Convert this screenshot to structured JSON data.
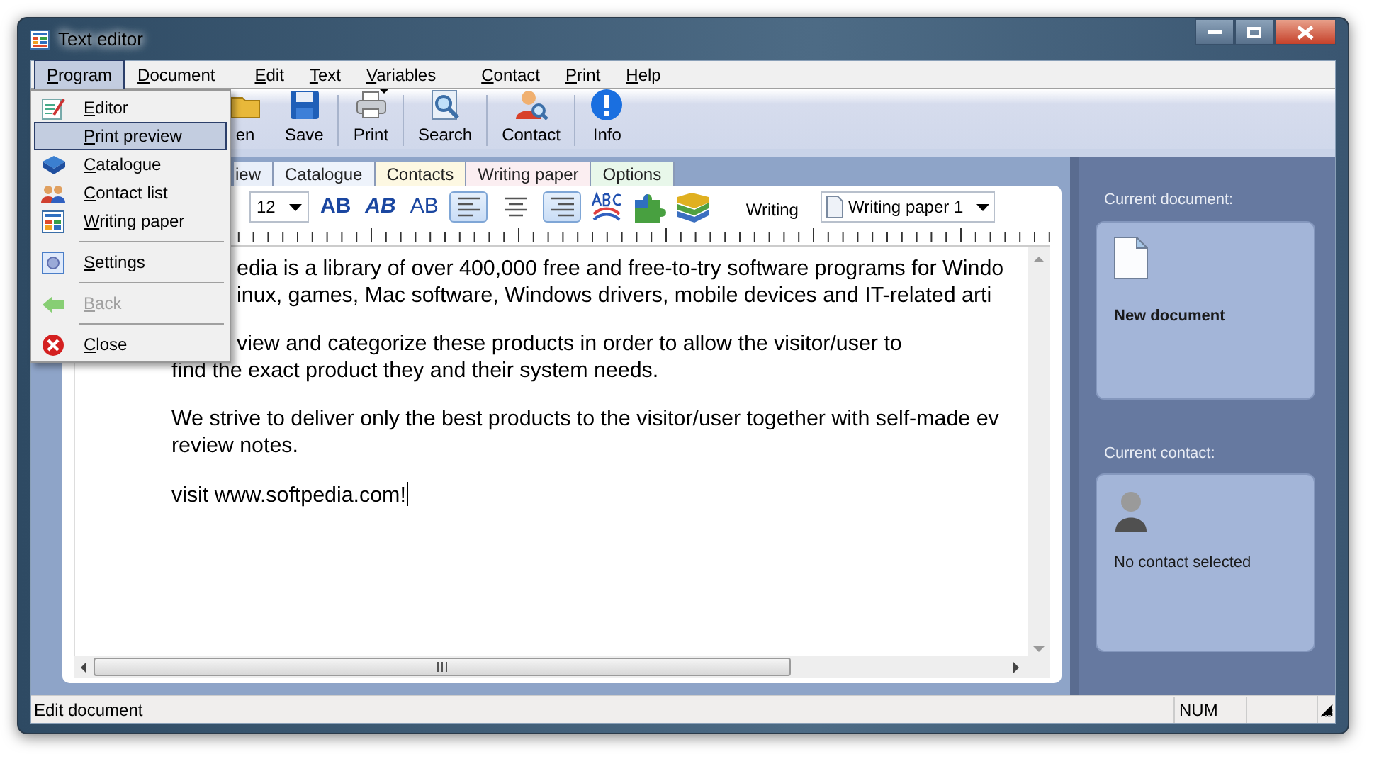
{
  "window": {
    "title": "Text editor"
  },
  "menu_bar": [
    {
      "label": "Program",
      "selected": true
    },
    {
      "label": "Document",
      "selected": false
    },
    {
      "label": "Edit",
      "selected": false
    },
    {
      "label": "Text",
      "selected": false
    },
    {
      "label": "Variables",
      "selected": false
    },
    {
      "label": "Contact",
      "selected": false
    },
    {
      "label": "Print",
      "selected": false
    },
    {
      "label": "Help",
      "selected": false
    }
  ],
  "open_menu": [
    {
      "kind": "item",
      "label": "Editor",
      "selected": false,
      "disabled": false
    },
    {
      "kind": "item",
      "label": "Print preview",
      "selected": true,
      "disabled": false
    },
    {
      "kind": "item",
      "label": "Catalogue",
      "selected": false,
      "disabled": false
    },
    {
      "kind": "item",
      "label": "Contact list",
      "selected": false,
      "disabled": false
    },
    {
      "kind": "item",
      "label": "Writing paper",
      "selected": false,
      "disabled": false
    },
    {
      "kind": "separator"
    },
    {
      "kind": "item",
      "label": "Settings",
      "selected": false,
      "disabled": false
    },
    {
      "kind": "separator"
    },
    {
      "kind": "item",
      "label": "Back",
      "selected": false,
      "disabled": true
    },
    {
      "kind": "separator"
    },
    {
      "kind": "item",
      "label": "Close",
      "selected": false,
      "disabled": false
    }
  ],
  "toolbar": [
    {
      "kind": "button",
      "label": "en"
    },
    {
      "kind": "button",
      "label": "Save"
    },
    {
      "kind": "separator"
    },
    {
      "kind": "button",
      "label": "Print"
    },
    {
      "kind": "separator"
    },
    {
      "kind": "button",
      "label": "Search"
    },
    {
      "kind": "separator"
    },
    {
      "kind": "button",
      "label": "Contact"
    },
    {
      "kind": "separator"
    },
    {
      "kind": "button",
      "label": "Info"
    }
  ],
  "tabs": [
    {
      "label": "iew",
      "color": "#e9eff9"
    },
    {
      "label": "Catalogue",
      "color": "#eef3fb"
    },
    {
      "label": "Contacts",
      "color": "#fdf8e2"
    },
    {
      "label": "Writing paper",
      "color": "#fbeef1"
    },
    {
      "label": "Options",
      "color": "#e8f7ea"
    }
  ],
  "format_bar": {
    "font_size": "12",
    "styles": [
      {
        "kind": "bold",
        "label": "AB"
      },
      {
        "kind": "italic",
        "label": "AB"
      },
      {
        "kind": "plain",
        "label": "AB"
      }
    ],
    "alignment": [
      {
        "kind": "left",
        "pressed": true
      },
      {
        "kind": "center",
        "pressed": false
      },
      {
        "kind": "right",
        "pressed": true
      }
    ],
    "writing_label": "Writing",
    "paper": "Writing paper 1"
  },
  "editor": {
    "lines": [
      {
        "kind": "covered",
        "text": "edia is a library of over 400,000 free and free-to-try software programs for Windo"
      },
      {
        "kind": "covered",
        "text": "inux, games, Mac software, Windows drivers, mobile devices and IT-related arti"
      },
      {
        "kind": "gap"
      },
      {
        "kind": "covered",
        "text": "view and categorize these products in order to allow the visitor/user to"
      },
      {
        "kind": "full",
        "text": "find the exact product they and their system needs."
      },
      {
        "kind": "gap"
      },
      {
        "kind": "full",
        "text": "We strive to deliver only the best products to the visitor/user together with self-made ev"
      },
      {
        "kind": "full",
        "text": "review notes."
      },
      {
        "kind": "gap"
      },
      {
        "kind": "full",
        "text": "visit www.softpedia.com!"
      }
    ]
  },
  "side_panel": {
    "sections": [
      {
        "heading": "Current document:",
        "kind": "document",
        "text": "New document"
      },
      {
        "heading": "Current contact:",
        "kind": "contact",
        "text": "No contact selected"
      }
    ]
  },
  "status_bar": [
    "Edit document",
    "NUM"
  ]
}
